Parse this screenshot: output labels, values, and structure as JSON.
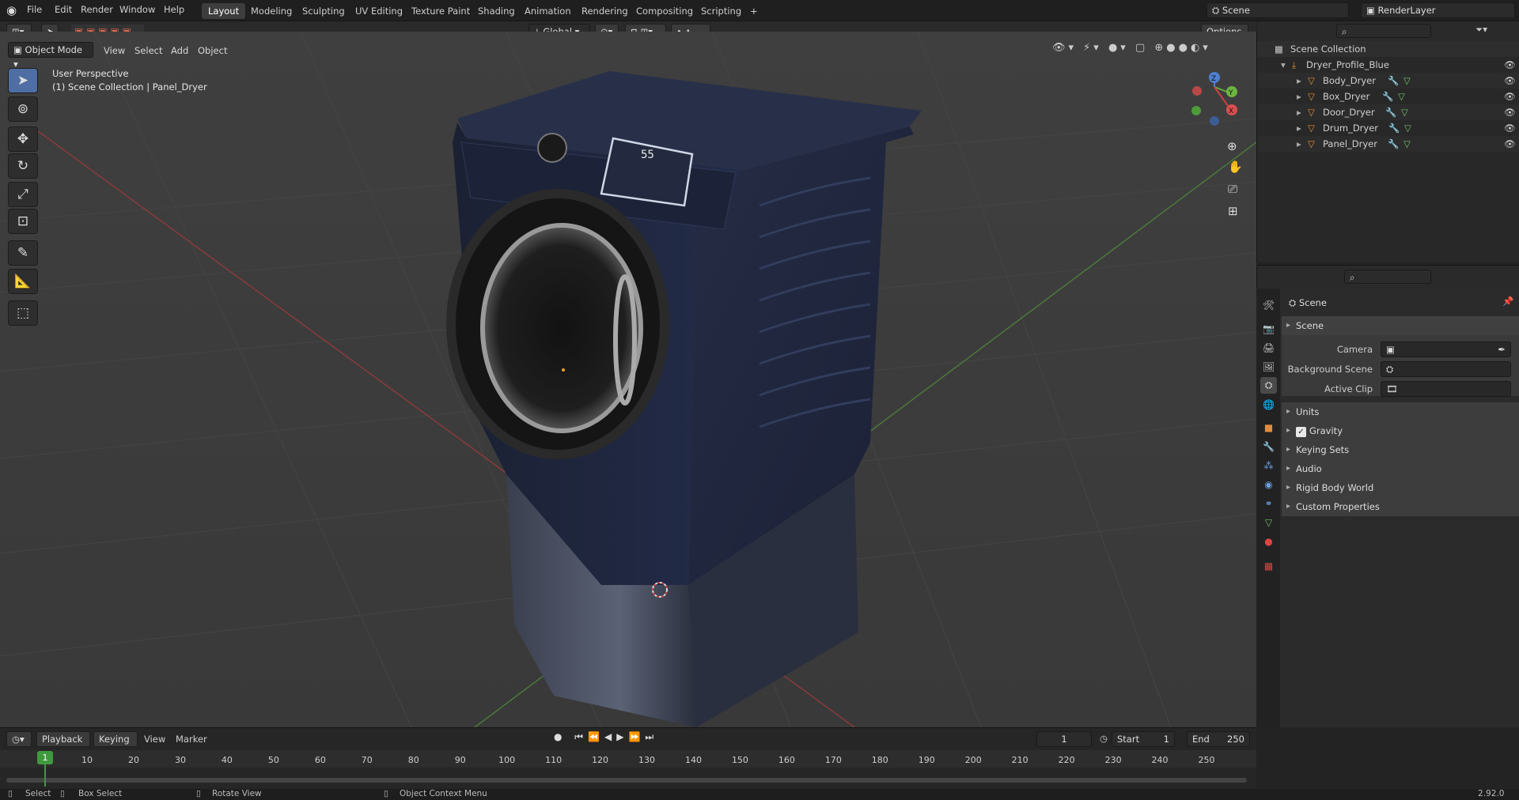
{
  "topbar": {
    "menus": [
      "File",
      "Edit",
      "Render",
      "Window",
      "Help"
    ],
    "workspaces": [
      "Layout",
      "Modeling",
      "Sculpting",
      "UV Editing",
      "Texture Paint",
      "Shading",
      "Animation",
      "Rendering",
      "Compositing",
      "Scripting"
    ],
    "active_workspace": "Layout",
    "scene_name": "Scene",
    "view_layer": "RenderLayer"
  },
  "viewport_header": {
    "mode": "Object Mode",
    "menus": [
      "View",
      "Select",
      "Add",
      "Object"
    ],
    "transform_orientation": "Global",
    "options_label": "Options"
  },
  "viewport": {
    "perspective_label": "User Perspective",
    "context_label": "(1) Scene Collection | Panel_Dryer",
    "display_text": "55",
    "gizmo_axes": [
      "Z",
      "Y",
      "X"
    ]
  },
  "outliner": {
    "root": "Scene Collection",
    "collection": "Dryer_Profile_Blue",
    "objects": [
      "Body_Dryer",
      "Box_Dryer",
      "Door_Dryer",
      "Drum_Dryer",
      "Panel_Dryer"
    ]
  },
  "properties": {
    "breadcrumb": "Scene",
    "section": "Scene",
    "fields": [
      {
        "label": "Camera",
        "value": ""
      },
      {
        "label": "Background Scene",
        "value": ""
      },
      {
        "label": "Active Clip",
        "value": ""
      }
    ],
    "panels": [
      "Units",
      "Gravity",
      "Keying Sets",
      "Audio",
      "Rigid Body World",
      "Custom Properties"
    ],
    "gravity_enabled": true
  },
  "timeline": {
    "menus": [
      "Playback",
      "Keying",
      "View",
      "Marker"
    ],
    "current_frame": "1",
    "start_label": "Start",
    "start": "1",
    "end_label": "End",
    "end": "250",
    "ticks": [
      "1",
      "10",
      "20",
      "30",
      "40",
      "50",
      "60",
      "70",
      "80",
      "90",
      "100",
      "110",
      "120",
      "130",
      "140",
      "150",
      "160",
      "170",
      "180",
      "190",
      "200",
      "210",
      "220",
      "230",
      "240",
      "250"
    ]
  },
  "statusbar": {
    "select": "Select",
    "box_select": "Box Select",
    "rotate_view": "Rotate View",
    "context_menu": "Object Context Menu",
    "version": "2.92.0"
  }
}
